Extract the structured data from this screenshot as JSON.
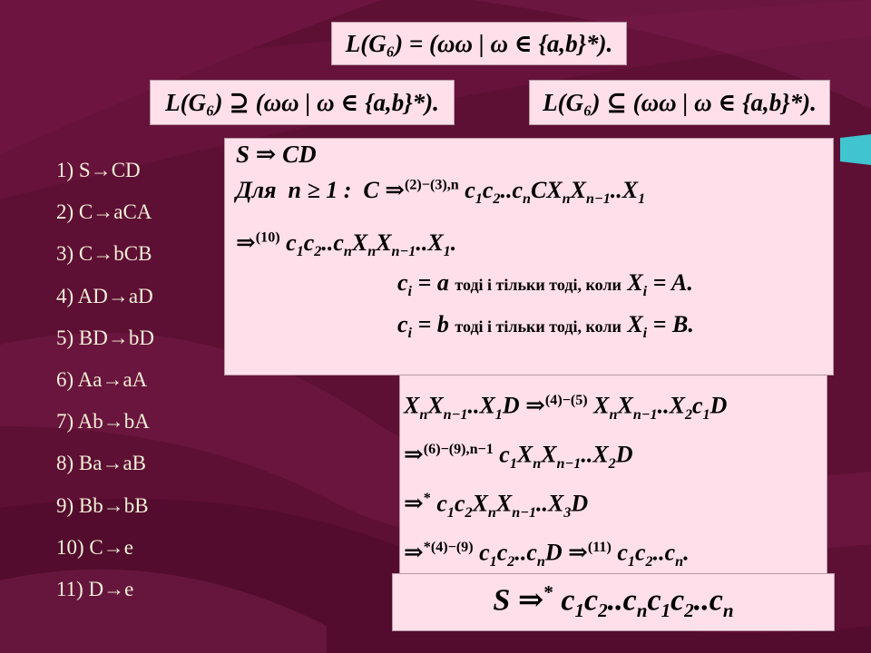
{
  "header": {
    "language_def": "L(G₆) = (ωω | ω ∈ {a,b}*).",
    "left_inclusion": "L(G₆) ⊇ (ωω | ω ∈ {a,b}*).",
    "right_inclusion": "L(G₆) ⊆ (ωω | ω ∈ {a,b}*)."
  },
  "rules": [
    "1)   S→CD",
    "2)  C→aCA",
    "3)  C→bCB",
    "4)  AD→aD",
    "5)  BD→bD",
    "6)  Aa→aA",
    "7)  Ab→bA",
    "8)  Ba→aB",
    "9)  Bb→bB",
    "10)  C→e",
    "11)  D→e"
  ],
  "derivation_box": {
    "start": "S ⇒ CD",
    "for_label": "Для",
    "condition_text": "тоді і тільки тоді, коли"
  },
  "colors": {
    "background": "#5e0f34",
    "box": "#ffdfea",
    "rules_text": "#f5f0d8",
    "accent_teal": "#3fc4d0"
  }
}
